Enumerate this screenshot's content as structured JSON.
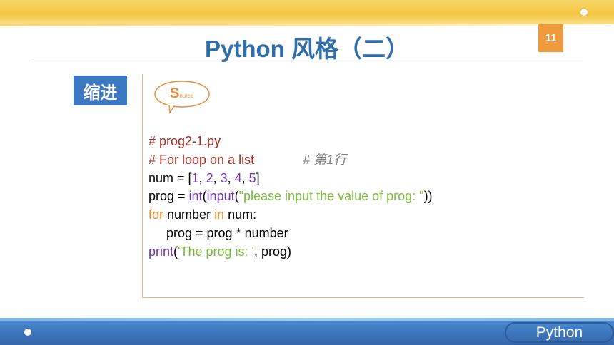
{
  "slide": {
    "title": "Python 风格（二）",
    "page_number": "11",
    "section_label": "缩进",
    "source_badge": {
      "big_letter": "S",
      "rest": "ource"
    },
    "footer_label": "Python"
  },
  "colors": {
    "top_bar": "#f3c640",
    "title": "#2f6eab",
    "page_badge": "#f09a3e",
    "section_label_bg": "#3b78c1",
    "frame_border": "#f0b27a",
    "footer": "#3c74b8",
    "comment": "#9b2b25",
    "number": "#7233b3",
    "keyword": "#f08a24",
    "string": "#79b93a"
  },
  "code": {
    "comment_filename": "# prog2-1.py",
    "comment_loop": "# For loop on a list",
    "comment_line_note": "# 第1行",
    "line3_prefix": "num = [",
    "n1": "1",
    "sep1": ", ",
    "n2": "2",
    "sep2": ", ",
    "n3": "3",
    "sep3": ", ",
    "n4": "4",
    "sep4": ", ",
    "n5": "5",
    "line3_suffix": "]",
    "line4_prefix": "prog = ",
    "fn_int": "int",
    "paren_open1": "(",
    "fn_input": "input",
    "paren_open2": "(",
    "prompt_str": "\"please input the value of prog: \"",
    "line4_suffix": "))",
    "kw_for": "for",
    "for_var": " number ",
    "kw_in": "in",
    "for_rest": " num:",
    "line6": "     prog = prog * number",
    "fn_print": "print",
    "print_open": "(",
    "print_str": "'The prog is: '",
    "print_rest": ", prog)"
  }
}
